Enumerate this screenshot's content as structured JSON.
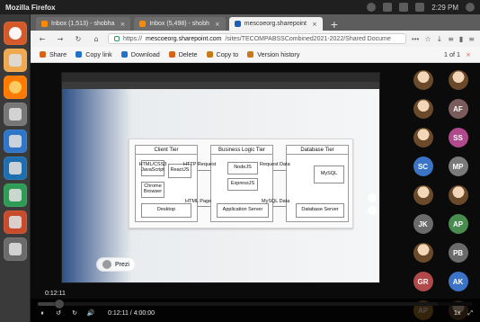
{
  "os": {
    "window_title": "Mozilla Firefox",
    "clock": "2:29 PM"
  },
  "tabs": [
    {
      "label": "Inbox (1,513) - shobha",
      "active": false
    },
    {
      "label": "Inbox (5,498) - shobh",
      "active": false
    },
    {
      "label": "mescoeorg.sharepoint",
      "active": true
    }
  ],
  "navbar": {
    "url_prefix": "https://",
    "url_host": "mescoeorg.sharepoint.com",
    "url_path": "/sites/TECOMPABSSCombined2021-2022/Shared Docume",
    "ellipsis": "•••"
  },
  "toolbar": {
    "share": "Share",
    "copy_link": "Copy link",
    "download": "Download",
    "delete": "Delete",
    "copy_to": "Copy to",
    "version_history": "Version history",
    "pager": "1 of 1"
  },
  "slide": {
    "client_tier": "Client Tier",
    "logic_tier": "Business Logic Tier",
    "db_tier": "Database Tier",
    "client_boxes": [
      "HTML/CSS3 JavaScript",
      "ReactJS",
      "Chrome Browser",
      "Desktop"
    ],
    "logic_boxes": [
      "NodeJS",
      "ExpressJS",
      "Application Server"
    ],
    "db_boxes": [
      "MySQL",
      "Database Server"
    ],
    "edges": {
      "http_request": "HTTP Request",
      "request_data": "Request Data",
      "html_page": "HTML Page",
      "mysql_data": "MySQL Data"
    },
    "prezi": "Prezi"
  },
  "participants": [
    {
      "initials": "",
      "label": "",
      "color": "#6b4a2b",
      "photo": true
    },
    {
      "initials": "",
      "label": "",
      "color": "#6b4a2b",
      "photo": true
    },
    {
      "initials": "",
      "label": "",
      "color": "#6b4a2b",
      "photo": true
    },
    {
      "initials": "AF",
      "label": "",
      "color": "#7a5b5b",
      "photo": false
    },
    {
      "initials": "",
      "label": "",
      "color": "#6b4a2b",
      "photo": true
    },
    {
      "initials": "SS",
      "label": "",
      "color": "#b04a8d",
      "photo": false
    },
    {
      "initials": "SC",
      "label": "",
      "color": "#3b74c6",
      "photo": false
    },
    {
      "initials": "MP",
      "label": "",
      "color": "#7a7a7a",
      "photo": false
    },
    {
      "initials": "",
      "label": "",
      "color": "#6b4a2b",
      "photo": true
    },
    {
      "initials": "",
      "label": "",
      "color": "#6b4a2b",
      "photo": true
    },
    {
      "initials": "JK",
      "label": "",
      "color": "#6b6b6b",
      "photo": false
    },
    {
      "initials": "AP",
      "label": "",
      "color": "#4a8b4f",
      "photo": false
    },
    {
      "initials": "",
      "label": "",
      "color": "#6b4a2b",
      "photo": true
    },
    {
      "initials": "PB",
      "label": "",
      "color": "#6b6b6b",
      "photo": false
    },
    {
      "initials": "GR",
      "label": "",
      "color": "#b04a4a",
      "photo": false
    },
    {
      "initials": "AK",
      "label": "",
      "color": "#3b74c6",
      "photo": false
    },
    {
      "initials": "AP",
      "label": "",
      "color": "#b07a2a",
      "photo": false
    },
    {
      "initials": "",
      "label": "",
      "color": "#6b4a2b",
      "photo": true
    }
  ],
  "player": {
    "time_bubble": "0:12:11",
    "current": "0:12:11",
    "duration": "4:00:00",
    "played_fraction": 0.05,
    "speed": "1x"
  }
}
